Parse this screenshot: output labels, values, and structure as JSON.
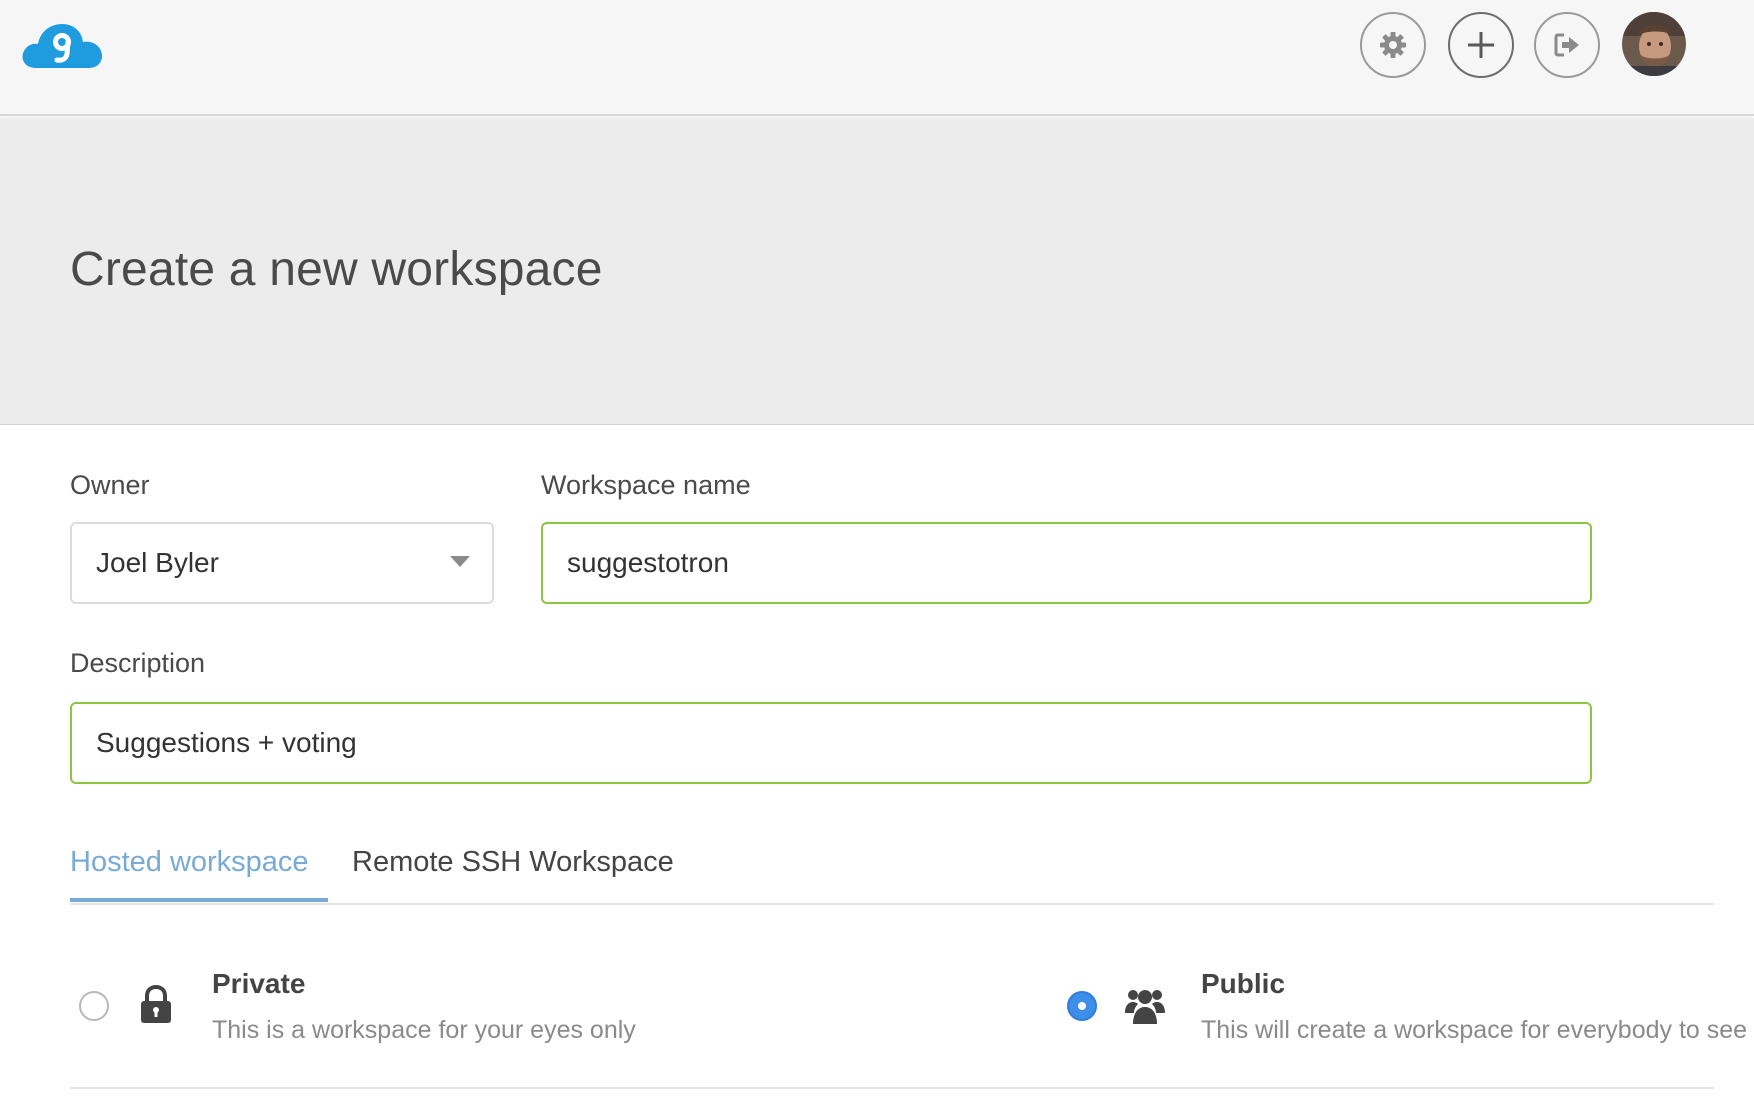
{
  "header": {
    "logo_icon": "cloud9-logo-icon",
    "buttons": [
      {
        "name": "settings",
        "icon": "gear-icon"
      },
      {
        "name": "create",
        "icon": "plus-icon"
      },
      {
        "name": "logout",
        "icon": "sign-out-icon"
      }
    ],
    "avatar": "user-avatar"
  },
  "page": {
    "title": "Create a new workspace"
  },
  "form": {
    "owner_label": "Owner",
    "owner_value": "Joel Byler",
    "name_label": "Workspace name",
    "name_value": "suggestotron",
    "description_label": "Description",
    "description_value": "Suggestions + voting"
  },
  "tabs": [
    {
      "label": "Hosted workspace",
      "active": true
    },
    {
      "label": "Remote SSH Workspace",
      "active": false
    }
  ],
  "visibility": {
    "private": {
      "title": "Private",
      "description": "This is a workspace for your eyes only",
      "selected": false,
      "icon": "lock-icon"
    },
    "public": {
      "title": "Public",
      "description": "This will create a workspace for everybody to see",
      "selected": true,
      "icon": "users-icon"
    }
  },
  "colors": {
    "accent": "#78aad6",
    "valid_border": "#8cc63f",
    "radio_selected": "#3c8ee8",
    "logo": "#1f9be0"
  }
}
